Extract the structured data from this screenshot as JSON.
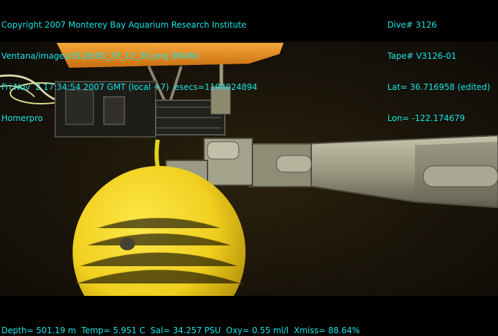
{
  "overlay": {
    "top_left": [
      "Copyright 2007 Monterey Bay Aquarium Research Institute",
      "Ventana/images/3126/00_33_12_26.png (MAIN)",
      "Fri Nov  2 17:34:54 2007 GMT (local +7)  esecs=1194024894",
      "Homerpro"
    ],
    "top_right": [
      "Dive# 3126",
      "Tape# V3126-01",
      "Lat= 36.716958 (edited)",
      "Lon= -122.174679"
    ],
    "bottom": "Depth= 501.19 m  Temp= 5.951 C  Sal= 34.257 PSU  Oxy= 0.55 ml/l  Xmiss= 88.64%"
  },
  "colors": {
    "overlay_text": "#19e6e6",
    "water": "#1a1406",
    "float": "#f2d21c",
    "plate": "#e8901c",
    "arm": "#9a9a84"
  }
}
